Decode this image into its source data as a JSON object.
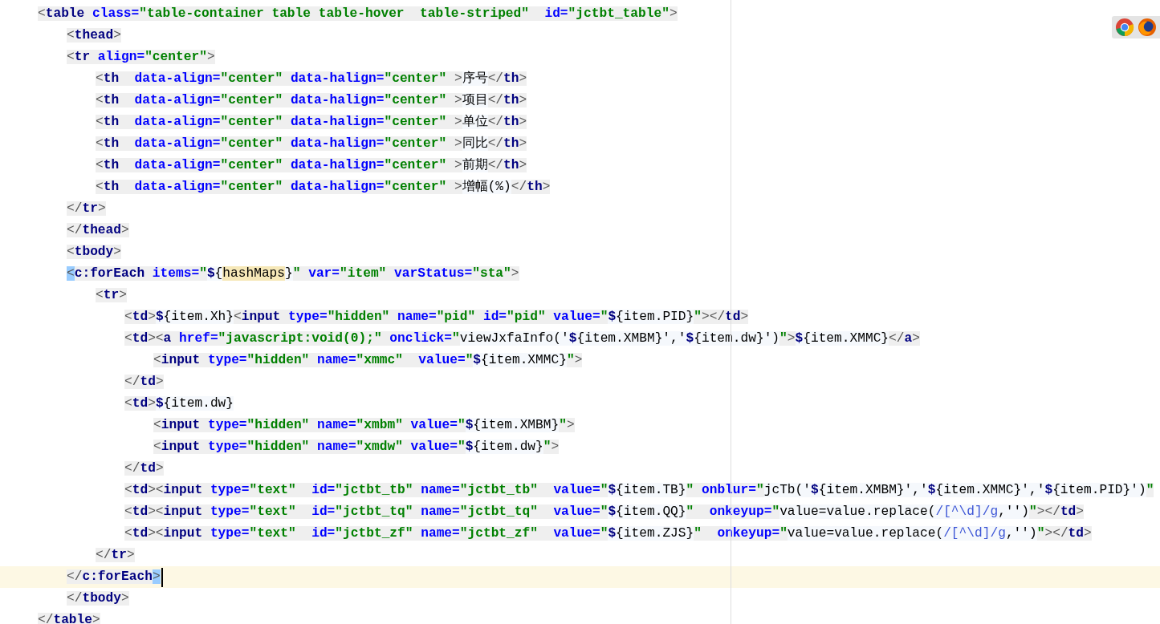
{
  "editor": {
    "lines": [
      {
        "current": false,
        "tokens": [
          {
            "kind": "p",
            "text": "<"
          },
          {
            "kind": "tag",
            "text": "table"
          },
          {
            "kind": "attr",
            "text": " class="
          },
          {
            "kind": "str",
            "text": "\"table-container table table-hover  table-striped\""
          },
          {
            "kind": "attr",
            "text": "  id="
          },
          {
            "kind": "str",
            "text": "\"jctbt_table\""
          },
          {
            "kind": "p",
            "text": ">"
          }
        ],
        "children": [
          {
            "current": false,
            "tokens": [
              {
                "kind": "p",
                "text": "<"
              },
              {
                "kind": "tag",
                "text": "thead"
              },
              {
                "kind": "p",
                "text": ">"
              }
            ]
          },
          {
            "current": false,
            "tokens": [
              {
                "kind": "p",
                "text": "<"
              },
              {
                "kind": "tag",
                "text": "tr"
              },
              {
                "kind": "attr",
                "text": " align="
              },
              {
                "kind": "str",
                "text": "\"center\""
              },
              {
                "kind": "p",
                "text": ">"
              }
            ],
            "children": [
              {
                "current": false,
                "tokens": [
                  {
                    "kind": "p",
                    "text": "<"
                  },
                  {
                    "kind": "tag",
                    "text": "th"
                  },
                  {
                    "kind": "attr",
                    "text": "  data-align="
                  },
                  {
                    "kind": "str",
                    "text": "\"center\""
                  },
                  {
                    "kind": "attr",
                    "text": " data-halign="
                  },
                  {
                    "kind": "str",
                    "text": "\"center\""
                  },
                  {
                    "kind": "p",
                    "text": " >"
                  },
                  {
                    "kind": "txt",
                    "text": "序号"
                  },
                  {
                    "kind": "p",
                    "text": "</"
                  },
                  {
                    "kind": "tag",
                    "text": "th"
                  },
                  {
                    "kind": "p",
                    "text": ">"
                  }
                ]
              },
              {
                "current": false,
                "tokens": [
                  {
                    "kind": "p",
                    "text": "<"
                  },
                  {
                    "kind": "tag",
                    "text": "th"
                  },
                  {
                    "kind": "attr",
                    "text": "  data-align="
                  },
                  {
                    "kind": "str",
                    "text": "\"center\""
                  },
                  {
                    "kind": "attr",
                    "text": " data-halign="
                  },
                  {
                    "kind": "str",
                    "text": "\"center\""
                  },
                  {
                    "kind": "p",
                    "text": " >"
                  },
                  {
                    "kind": "txt",
                    "text": "项目"
                  },
                  {
                    "kind": "p",
                    "text": "</"
                  },
                  {
                    "kind": "tag",
                    "text": "th"
                  },
                  {
                    "kind": "p",
                    "text": ">"
                  }
                ]
              },
              {
                "current": false,
                "tokens": [
                  {
                    "kind": "p",
                    "text": "<"
                  },
                  {
                    "kind": "tag",
                    "text": "th"
                  },
                  {
                    "kind": "attr",
                    "text": "  data-align="
                  },
                  {
                    "kind": "str",
                    "text": "\"center\""
                  },
                  {
                    "kind": "attr",
                    "text": " data-halign="
                  },
                  {
                    "kind": "str",
                    "text": "\"center\""
                  },
                  {
                    "kind": "p",
                    "text": " >"
                  },
                  {
                    "kind": "txt",
                    "text": "单位"
                  },
                  {
                    "kind": "p",
                    "text": "</"
                  },
                  {
                    "kind": "tag",
                    "text": "th"
                  },
                  {
                    "kind": "p",
                    "text": ">"
                  }
                ]
              },
              {
                "current": false,
                "tokens": [
                  {
                    "kind": "p",
                    "text": "<"
                  },
                  {
                    "kind": "tag",
                    "text": "th"
                  },
                  {
                    "kind": "attr",
                    "text": "  data-align="
                  },
                  {
                    "kind": "str",
                    "text": "\"center\""
                  },
                  {
                    "kind": "attr",
                    "text": " data-halign="
                  },
                  {
                    "kind": "str",
                    "text": "\"center\""
                  },
                  {
                    "kind": "p",
                    "text": " >"
                  },
                  {
                    "kind": "txt",
                    "text": "同比"
                  },
                  {
                    "kind": "p",
                    "text": "</"
                  },
                  {
                    "kind": "tag",
                    "text": "th"
                  },
                  {
                    "kind": "p",
                    "text": ">"
                  }
                ]
              },
              {
                "current": false,
                "tokens": [
                  {
                    "kind": "p",
                    "text": "<"
                  },
                  {
                    "kind": "tag",
                    "text": "th"
                  },
                  {
                    "kind": "attr",
                    "text": "  data-align="
                  },
                  {
                    "kind": "str",
                    "text": "\"center\""
                  },
                  {
                    "kind": "attr",
                    "text": " data-halign="
                  },
                  {
                    "kind": "str",
                    "text": "\"center\""
                  },
                  {
                    "kind": "p",
                    "text": " >"
                  },
                  {
                    "kind": "txt",
                    "text": "前期"
                  },
                  {
                    "kind": "p",
                    "text": "</"
                  },
                  {
                    "kind": "tag",
                    "text": "th"
                  },
                  {
                    "kind": "p",
                    "text": ">"
                  }
                ]
              },
              {
                "current": false,
                "tokens": [
                  {
                    "kind": "p",
                    "text": "<"
                  },
                  {
                    "kind": "tag",
                    "text": "th"
                  },
                  {
                    "kind": "attr",
                    "text": "  data-align="
                  },
                  {
                    "kind": "str",
                    "text": "\"center\""
                  },
                  {
                    "kind": "attr",
                    "text": " data-halign="
                  },
                  {
                    "kind": "str",
                    "text": "\"center\""
                  },
                  {
                    "kind": "p",
                    "text": " >"
                  },
                  {
                    "kind": "txt",
                    "text": "增幅(%)"
                  },
                  {
                    "kind": "p",
                    "text": "</"
                  },
                  {
                    "kind": "tag",
                    "text": "th"
                  },
                  {
                    "kind": "p",
                    "text": ">"
                  }
                ]
              }
            ]
          },
          {
            "current": false,
            "tokens": [
              {
                "kind": "p",
                "text": "</"
              },
              {
                "kind": "tag",
                "text": "tr"
              },
              {
                "kind": "p",
                "text": ">"
              }
            ]
          },
          {
            "current": false,
            "tokens": [
              {
                "kind": "p",
                "text": "</"
              },
              {
                "kind": "tag",
                "text": "thead"
              },
              {
                "kind": "p",
                "text": ">"
              }
            ]
          },
          {
            "current": false,
            "tokens": [
              {
                "kind": "p",
                "text": "<"
              },
              {
                "kind": "tag",
                "text": "tbody"
              },
              {
                "kind": "p",
                "text": ">"
              }
            ]
          },
          {
            "current": false,
            "tokens": [
              {
                "kind": "brace",
                "text": "<"
              },
              {
                "kind": "tag",
                "text": "c:forEach"
              },
              {
                "kind": "attr",
                "text": " items="
              },
              {
                "kind": "str",
                "text": "\""
              },
              {
                "kind": "el",
                "text": "$"
              },
              {
                "kind": "txt",
                "text": "{"
              },
              {
                "kind": "usage",
                "text": "hashMaps"
              },
              {
                "kind": "txt",
                "text": "}"
              },
              {
                "kind": "str",
                "text": "\""
              },
              {
                "kind": "attr",
                "text": " var="
              },
              {
                "kind": "str",
                "text": "\"item\""
              },
              {
                "kind": "attr",
                "text": " varStatus="
              },
              {
                "kind": "str",
                "text": "\"sta\""
              },
              {
                "kind": "p",
                "text": ">"
              }
            ],
            "children": [
              {
                "current": false,
                "tokens": [
                  {
                    "kind": "p",
                    "text": "<"
                  },
                  {
                    "kind": "tag",
                    "text": "tr"
                  },
                  {
                    "kind": "p",
                    "text": ">"
                  }
                ],
                "children": [
                  {
                    "current": false,
                    "tokens": [
                      {
                        "kind": "p",
                        "text": "<"
                      },
                      {
                        "kind": "tag",
                        "text": "td"
                      },
                      {
                        "kind": "p",
                        "text": ">"
                      },
                      {
                        "kind": "el",
                        "text": "$"
                      },
                      {
                        "kind": "txt",
                        "text": "{item.Xh}"
                      },
                      {
                        "kind": "p",
                        "text": "<"
                      },
                      {
                        "kind": "tag",
                        "text": "input"
                      },
                      {
                        "kind": "attr",
                        "text": " type="
                      },
                      {
                        "kind": "str",
                        "text": "\"hidden\""
                      },
                      {
                        "kind": "attr",
                        "text": " name="
                      },
                      {
                        "kind": "str",
                        "text": "\"pid\""
                      },
                      {
                        "kind": "attr",
                        "text": " id="
                      },
                      {
                        "kind": "str",
                        "text": "\"pid\""
                      },
                      {
                        "kind": "attr",
                        "text": " value="
                      },
                      {
                        "kind": "str",
                        "text": "\""
                      },
                      {
                        "kind": "el",
                        "text": "$"
                      },
                      {
                        "kind": "txt",
                        "text": "{item.PID}"
                      },
                      {
                        "kind": "str",
                        "text": "\""
                      },
                      {
                        "kind": "p",
                        "text": "></"
                      },
                      {
                        "kind": "tag",
                        "text": "td"
                      },
                      {
                        "kind": "p",
                        "text": ">"
                      }
                    ]
                  },
                  {
                    "current": false,
                    "tokens": [
                      {
                        "kind": "p",
                        "text": "<"
                      },
                      {
                        "kind": "tag",
                        "text": "td"
                      },
                      {
                        "kind": "p",
                        "text": "><"
                      },
                      {
                        "kind": "tag",
                        "text": "a"
                      },
                      {
                        "kind": "attr",
                        "text": " href="
                      },
                      {
                        "kind": "str",
                        "text": "\"javascript:void(0);\""
                      },
                      {
                        "kind": "attr",
                        "text": " onclick="
                      },
                      {
                        "kind": "str",
                        "text": "\""
                      },
                      {
                        "kind": "txt",
                        "text": "viewJxfaInfo('"
                      },
                      {
                        "kind": "el",
                        "text": "$"
                      },
                      {
                        "kind": "txt",
                        "text": "{item.XMBM}','"
                      },
                      {
                        "kind": "el",
                        "text": "$"
                      },
                      {
                        "kind": "txt",
                        "text": "{item.dw}')"
                      },
                      {
                        "kind": "str",
                        "text": "\""
                      },
                      {
                        "kind": "p",
                        "text": ">"
                      },
                      {
                        "kind": "el",
                        "text": "$"
                      },
                      {
                        "kind": "txt",
                        "text": "{item.XMMC}"
                      },
                      {
                        "kind": "p",
                        "text": "</"
                      },
                      {
                        "kind": "tag",
                        "text": "a"
                      },
                      {
                        "kind": "p",
                        "text": ">"
                      }
                    ],
                    "children": [
                      {
                        "current": false,
                        "tokens": [
                          {
                            "kind": "p",
                            "text": "<"
                          },
                          {
                            "kind": "tag",
                            "text": "input"
                          },
                          {
                            "kind": "attr",
                            "text": " type="
                          },
                          {
                            "kind": "str",
                            "text": "\"hidden\""
                          },
                          {
                            "kind": "attr",
                            "text": " name="
                          },
                          {
                            "kind": "str",
                            "text": "\"xmmc\""
                          },
                          {
                            "kind": "attr",
                            "text": "  value="
                          },
                          {
                            "kind": "str",
                            "text": "\""
                          },
                          {
                            "kind": "el",
                            "text": "$"
                          },
                          {
                            "kind": "txt",
                            "text": "{item.XMMC}"
                          },
                          {
                            "kind": "str",
                            "text": "\""
                          },
                          {
                            "kind": "p",
                            "text": ">"
                          }
                        ]
                      }
                    ]
                  },
                  {
                    "current": false,
                    "tokens": [
                      {
                        "kind": "p",
                        "text": "</"
                      },
                      {
                        "kind": "tag",
                        "text": "td"
                      },
                      {
                        "kind": "p",
                        "text": ">"
                      }
                    ]
                  },
                  {
                    "current": false,
                    "tokens": [
                      {
                        "kind": "p",
                        "text": "<"
                      },
                      {
                        "kind": "tag",
                        "text": "td"
                      },
                      {
                        "kind": "p",
                        "text": ">"
                      },
                      {
                        "kind": "el",
                        "text": "$"
                      },
                      {
                        "kind": "txt",
                        "text": "{item.dw}"
                      }
                    ],
                    "children": [
                      {
                        "current": false,
                        "tokens": [
                          {
                            "kind": "p",
                            "text": "<"
                          },
                          {
                            "kind": "tag",
                            "text": "input"
                          },
                          {
                            "kind": "attr",
                            "text": " type="
                          },
                          {
                            "kind": "str",
                            "text": "\"hidden\""
                          },
                          {
                            "kind": "attr",
                            "text": " name="
                          },
                          {
                            "kind": "str",
                            "text": "\"xmbm\""
                          },
                          {
                            "kind": "attr",
                            "text": " value="
                          },
                          {
                            "kind": "str",
                            "text": "\""
                          },
                          {
                            "kind": "el",
                            "text": "$"
                          },
                          {
                            "kind": "txt",
                            "text": "{item.XMBM}"
                          },
                          {
                            "kind": "str",
                            "text": "\""
                          },
                          {
                            "kind": "p",
                            "text": ">"
                          }
                        ]
                      },
                      {
                        "current": false,
                        "tokens": [
                          {
                            "kind": "p",
                            "text": "<"
                          },
                          {
                            "kind": "tag",
                            "text": "input"
                          },
                          {
                            "kind": "attr",
                            "text": " type="
                          },
                          {
                            "kind": "str",
                            "text": "\"hidden\""
                          },
                          {
                            "kind": "attr",
                            "text": " name="
                          },
                          {
                            "kind": "str",
                            "text": "\"xmdw\""
                          },
                          {
                            "kind": "attr",
                            "text": " value="
                          },
                          {
                            "kind": "str",
                            "text": "\""
                          },
                          {
                            "kind": "el",
                            "text": "$"
                          },
                          {
                            "kind": "txt",
                            "text": "{item.dw}"
                          },
                          {
                            "kind": "str",
                            "text": "\""
                          },
                          {
                            "kind": "p",
                            "text": ">"
                          }
                        ]
                      }
                    ]
                  },
                  {
                    "current": false,
                    "tokens": [
                      {
                        "kind": "p",
                        "text": "</"
                      },
                      {
                        "kind": "tag",
                        "text": "td"
                      },
                      {
                        "kind": "p",
                        "text": ">"
                      }
                    ]
                  },
                  {
                    "current": false,
                    "tokens": [
                      {
                        "kind": "p",
                        "text": "<"
                      },
                      {
                        "kind": "tag",
                        "text": "td"
                      },
                      {
                        "kind": "p",
                        "text": "><"
                      },
                      {
                        "kind": "tag",
                        "text": "input"
                      },
                      {
                        "kind": "attr",
                        "text": " type="
                      },
                      {
                        "kind": "str",
                        "text": "\"text\""
                      },
                      {
                        "kind": "attr",
                        "text": "  id="
                      },
                      {
                        "kind": "str",
                        "text": "\"jctbt_tb\""
                      },
                      {
                        "kind": "attr",
                        "text": " name="
                      },
                      {
                        "kind": "str",
                        "text": "\"jctbt_tb\""
                      },
                      {
                        "kind": "attr",
                        "text": "  value="
                      },
                      {
                        "kind": "str",
                        "text": "\""
                      },
                      {
                        "kind": "el",
                        "text": "$"
                      },
                      {
                        "kind": "txt",
                        "text": "{item.TB}"
                      },
                      {
                        "kind": "str",
                        "text": "\""
                      },
                      {
                        "kind": "attr",
                        "text": " onblur="
                      },
                      {
                        "kind": "str",
                        "text": "\""
                      },
                      {
                        "kind": "txt",
                        "text": "jcTb('"
                      },
                      {
                        "kind": "el",
                        "text": "$"
                      },
                      {
                        "kind": "txt",
                        "text": "{item.XMBM}','"
                      },
                      {
                        "kind": "el",
                        "text": "$"
                      },
                      {
                        "kind": "txt",
                        "text": "{item.XMMC}','"
                      },
                      {
                        "kind": "el",
                        "text": "$"
                      },
                      {
                        "kind": "txt",
                        "text": "{item.PID}')"
                      },
                      {
                        "kind": "str",
                        "text": "\""
                      }
                    ]
                  },
                  {
                    "current": false,
                    "tokens": [
                      {
                        "kind": "p",
                        "text": "<"
                      },
                      {
                        "kind": "tag",
                        "text": "td"
                      },
                      {
                        "kind": "p",
                        "text": "><"
                      },
                      {
                        "kind": "tag",
                        "text": "input"
                      },
                      {
                        "kind": "attr",
                        "text": " type="
                      },
                      {
                        "kind": "str",
                        "text": "\"text\""
                      },
                      {
                        "kind": "attr",
                        "text": "  id="
                      },
                      {
                        "kind": "str",
                        "text": "\"jctbt_tq\""
                      },
                      {
                        "kind": "attr",
                        "text": " name="
                      },
                      {
                        "kind": "str",
                        "text": "\"jctbt_tq\""
                      },
                      {
                        "kind": "attr",
                        "text": "  value="
                      },
                      {
                        "kind": "str",
                        "text": "\""
                      },
                      {
                        "kind": "el",
                        "text": "$"
                      },
                      {
                        "kind": "txt",
                        "text": "{item.QQ}"
                      },
                      {
                        "kind": "str",
                        "text": "\""
                      },
                      {
                        "kind": "attr",
                        "text": "  onkeyup="
                      },
                      {
                        "kind": "str",
                        "text": "\""
                      },
                      {
                        "kind": "txt",
                        "text": "value=value.replace("
                      },
                      {
                        "kind": "regex",
                        "text": "/[^\\d]/g"
                      },
                      {
                        "kind": "txt",
                        "text": ",'')"
                      },
                      {
                        "kind": "str",
                        "text": "\""
                      },
                      {
                        "kind": "p",
                        "text": "></"
                      },
                      {
                        "kind": "tag",
                        "text": "td"
                      },
                      {
                        "kind": "p",
                        "text": ">"
                      }
                    ]
                  },
                  {
                    "current": false,
                    "tokens": [
                      {
                        "kind": "p",
                        "text": "<"
                      },
                      {
                        "kind": "tag",
                        "text": "td"
                      },
                      {
                        "kind": "p",
                        "text": "><"
                      },
                      {
                        "kind": "tag",
                        "text": "input"
                      },
                      {
                        "kind": "attr",
                        "text": " type="
                      },
                      {
                        "kind": "str",
                        "text": "\"text\""
                      },
                      {
                        "kind": "attr",
                        "text": "  id="
                      },
                      {
                        "kind": "str",
                        "text": "\"jctbt_zf\""
                      },
                      {
                        "kind": "attr",
                        "text": " name="
                      },
                      {
                        "kind": "str",
                        "text": "\"jctbt_zf\""
                      },
                      {
                        "kind": "attr",
                        "text": "  value="
                      },
                      {
                        "kind": "str",
                        "text": "\""
                      },
                      {
                        "kind": "el",
                        "text": "$"
                      },
                      {
                        "kind": "txt",
                        "text": "{item.ZJS}"
                      },
                      {
                        "kind": "str",
                        "text": "\""
                      },
                      {
                        "kind": "attr",
                        "text": "  onkeyup="
                      },
                      {
                        "kind": "str",
                        "text": "\""
                      },
                      {
                        "kind": "txt",
                        "text": "value=value.replace("
                      },
                      {
                        "kind": "regex",
                        "text": "/[^\\d]/g"
                      },
                      {
                        "kind": "txt",
                        "text": ",'')"
                      },
                      {
                        "kind": "str",
                        "text": "\""
                      },
                      {
                        "kind": "p",
                        "text": "></"
                      },
                      {
                        "kind": "tag",
                        "text": "td"
                      },
                      {
                        "kind": "p",
                        "text": ">"
                      }
                    ]
                  }
                ]
              },
              {
                "current": false,
                "tokens": [
                  {
                    "kind": "p",
                    "text": "</"
                  },
                  {
                    "kind": "tag",
                    "text": "tr"
                  },
                  {
                    "kind": "p",
                    "text": ">"
                  }
                ]
              }
            ]
          },
          {
            "current": true,
            "tokens": [
              {
                "kind": "p",
                "text": "</"
              },
              {
                "kind": "tag",
                "text": "c:forEach"
              },
              {
                "kind": "brace",
                "text": ">"
              }
            ]
          },
          {
            "current": false,
            "tokens": [
              {
                "kind": "p",
                "text": "</"
              },
              {
                "kind": "tag",
                "text": "tbody"
              },
              {
                "kind": "p",
                "text": ">"
              }
            ]
          }
        ]
      },
      {
        "current": false,
        "tokens": [
          {
            "kind": "p",
            "text": "</"
          },
          {
            "kind": "tag",
            "text": "table"
          },
          {
            "kind": "p",
            "text": ">"
          }
        ]
      }
    ]
  },
  "browser_icons": [
    {
      "kind": "chrome"
    },
    {
      "kind": "firefox"
    }
  ]
}
